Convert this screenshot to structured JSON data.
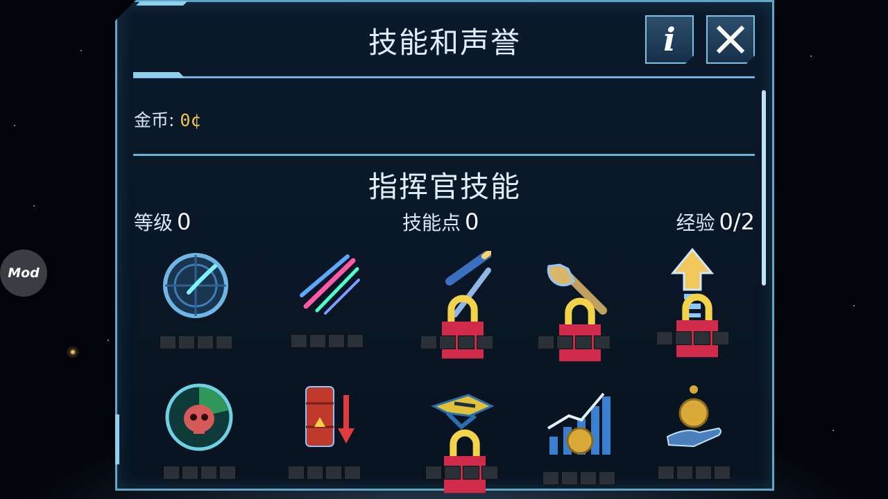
{
  "mod_button": {
    "label": "Mod"
  },
  "dialog": {
    "title": "技能和声誉",
    "info_label": "i",
    "close_label": "✕"
  },
  "currency": {
    "label": "金币:",
    "value": "0¢"
  },
  "commander_skills": {
    "title": "指挥官技能",
    "level_label": "等级",
    "level_value": "0",
    "points_label": "技能点",
    "points_value": "0",
    "exp_label": "经验",
    "exp_value": "0/2"
  },
  "skills": [
    {
      "icon": "radar-scan-icon",
      "locked": false,
      "pips_filled": 0,
      "pips_total": 4
    },
    {
      "icon": "comet-burst-icon",
      "locked": false,
      "pips_filled": 0,
      "pips_total": 4
    },
    {
      "icon": "missile-icon",
      "locked": true,
      "pips_filled": 0,
      "pips_total": 4
    },
    {
      "icon": "wrench-icon",
      "locked": true,
      "pips_filled": 0,
      "pips_total": 4
    },
    {
      "icon": "upgrade-arrow-icon",
      "locked": true,
      "pips_filled": 0,
      "pips_total": 4
    },
    {
      "icon": "skull-radar-icon",
      "locked": false,
      "pips_filled": 0,
      "pips_total": 4
    },
    {
      "icon": "fuel-barrel-down-icon",
      "locked": false,
      "pips_filled": 0,
      "pips_total": 4
    },
    {
      "icon": "fighter-ship-icon",
      "locked": true,
      "pips_filled": 0,
      "pips_total": 4
    },
    {
      "icon": "income-chart-icon",
      "locked": false,
      "pips_filled": 0,
      "pips_total": 4
    },
    {
      "icon": "coin-hand-icon",
      "locked": false,
      "pips_filled": 0,
      "pips_total": 4
    }
  ],
  "colors": {
    "border": "#5fa6c9",
    "coin_value": "#f2c84b",
    "text": "#d6e9f5"
  }
}
